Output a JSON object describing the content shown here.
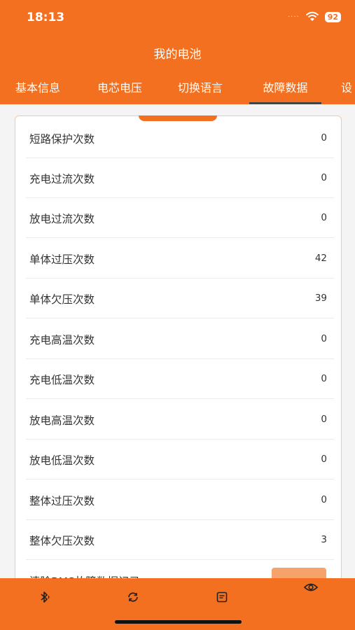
{
  "status": {
    "time": "18:13",
    "battery": "92",
    "signal": "····"
  },
  "header": {
    "title": "我的电池"
  },
  "tabs": [
    {
      "label": "基本信息"
    },
    {
      "label": "电芯电压"
    },
    {
      "label": "切换语言"
    },
    {
      "label": "故障数据",
      "active": true
    },
    {
      "label": "设"
    }
  ],
  "fault_rows": [
    {
      "label": "短路保护次数",
      "value": "0"
    },
    {
      "label": "充电过流次数",
      "value": "0"
    },
    {
      "label": "放电过流次数",
      "value": "0"
    },
    {
      "label": "单体过压次数",
      "value": "42"
    },
    {
      "label": "单体欠压次数",
      "value": "39"
    },
    {
      "label": "充电高温次数",
      "value": "0"
    },
    {
      "label": "充电低温次数",
      "value": "0"
    },
    {
      "label": "放电高温次数",
      "value": "0"
    },
    {
      "label": "放电低温次数",
      "value": "0"
    },
    {
      "label": "整体过压次数",
      "value": "0"
    },
    {
      "label": "整体欠压次数",
      "value": "3"
    }
  ],
  "clear_row": {
    "label": "清除BMS故障数据记录"
  },
  "bottom_nav": [
    {
      "icon": "bluetooth-icon"
    },
    {
      "icon": "refresh-icon"
    },
    {
      "icon": "document-icon"
    },
    {
      "icon": "eye-icon"
    }
  ],
  "colors": {
    "accent": "#f2701f",
    "button": "#f5a36b"
  }
}
